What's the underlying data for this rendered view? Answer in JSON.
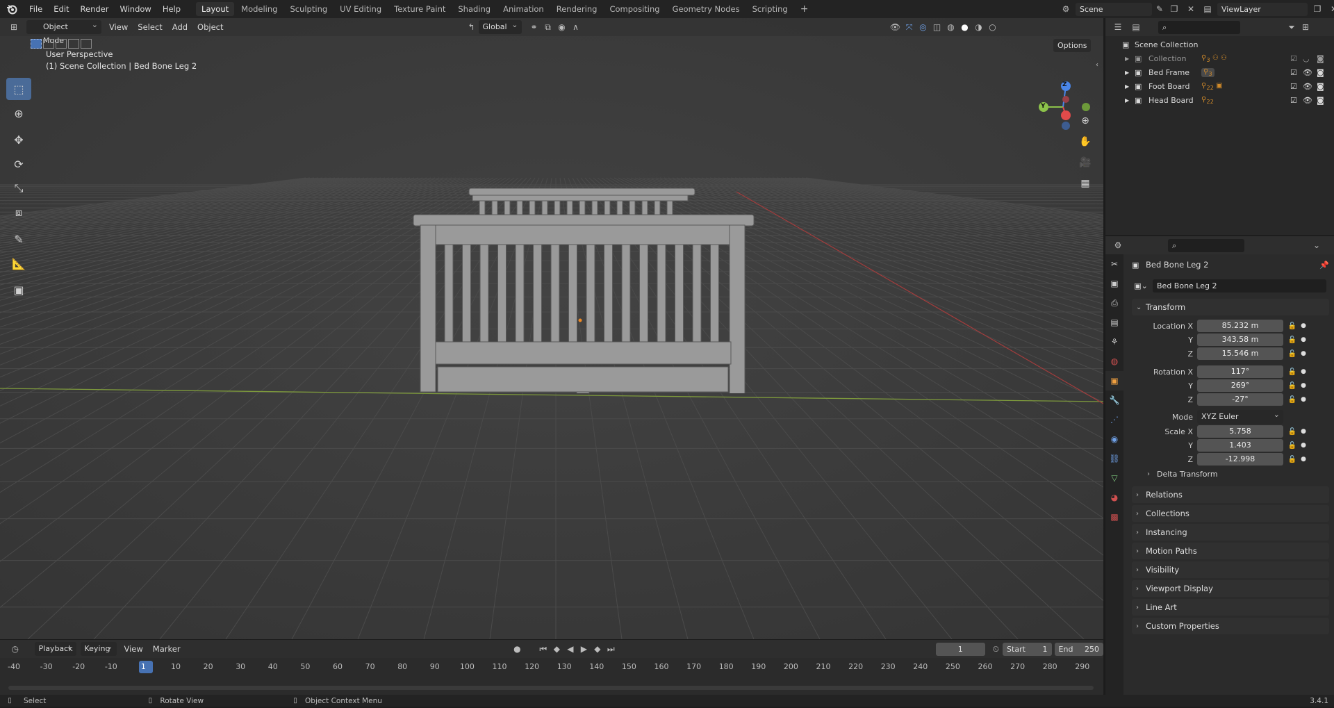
{
  "topbar": {
    "menus": [
      "File",
      "Edit",
      "Render",
      "Window",
      "Help"
    ],
    "workspaces": [
      "Layout",
      "Modeling",
      "Sculpting",
      "UV Editing",
      "Texture Paint",
      "Shading",
      "Animation",
      "Rendering",
      "Compositing",
      "Geometry Nodes",
      "Scripting"
    ],
    "active_workspace": "Layout",
    "add_tab": "+",
    "scene": "Scene",
    "view_layer": "ViewLayer"
  },
  "viewport": {
    "mode": "Object Mode",
    "menus": [
      "View",
      "Select",
      "Add",
      "Object"
    ],
    "orientation": "Global",
    "options": "Options",
    "overlay_title": "User Perspective",
    "overlay_subtitle": "(1) Scene Collection | Bed Bone Leg 2",
    "gizmo": {
      "z": "Z",
      "y": "Y"
    }
  },
  "timeline": {
    "menus": [
      "Playback",
      "Keying",
      "View",
      "Marker"
    ],
    "current_frame": "1",
    "start_label": "Start",
    "start": "1",
    "end_label": "End",
    "end": "250",
    "ticks": [
      "-40",
      "-30",
      "-20",
      "-10",
      "1",
      "10",
      "20",
      "30",
      "40",
      "50",
      "60",
      "70",
      "80",
      "90",
      "100",
      "110",
      "120",
      "130",
      "140",
      "150",
      "160",
      "170",
      "180",
      "190",
      "200",
      "210",
      "220",
      "230",
      "240",
      "250",
      "260",
      "270",
      "280",
      "290"
    ]
  },
  "statusbar": {
    "items": [
      "Select",
      "Rotate View",
      "Object Context Menu"
    ],
    "version": "3.4.1"
  },
  "outliner": {
    "root": "Scene Collection",
    "items": [
      {
        "name": "Collection",
        "badge": "3"
      },
      {
        "name": "Bed Frame",
        "badge": "3"
      },
      {
        "name": "Foot Board",
        "badge": "22"
      },
      {
        "name": "Head Board",
        "badge": "22"
      }
    ]
  },
  "properties": {
    "object_name": "Bed Bone Leg 2",
    "datablock_name": "Bed Bone Leg 2",
    "transform_label": "Transform",
    "location": {
      "label": "Location X",
      "x": "85.232 m",
      "y": "343.58 m",
      "z": "15.546 m"
    },
    "rotation": {
      "label": "Rotation X",
      "x": "117°",
      "y": "269°",
      "z": "-27°"
    },
    "mode_label": "Mode",
    "mode": "XYZ Euler",
    "scale": {
      "label": "Scale X",
      "x": "5.758",
      "y": "1.403",
      "z": "-12.998"
    },
    "axis_y": "Y",
    "axis_z": "Z",
    "delta": "Delta Transform",
    "panels": [
      "Relations",
      "Collections",
      "Instancing",
      "Motion Paths",
      "Visibility",
      "Viewport Display",
      "Line Art",
      "Custom Properties"
    ]
  },
  "colors": {
    "accent": "#4772b3",
    "x_axis": "#e04a4a",
    "y_axis": "#8cc24a",
    "z_axis": "#4a86e8"
  }
}
